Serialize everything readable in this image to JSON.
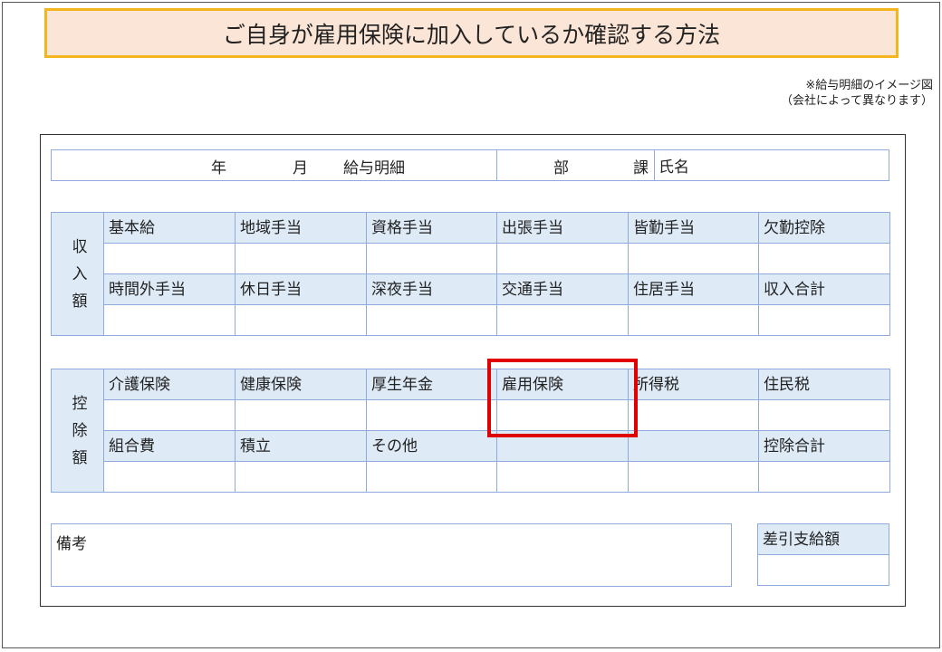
{
  "title": "ご自身が雇用保険に加入しているか確認する方法",
  "note": {
    "line1": "※給与明細のイメージ図",
    "line2": "（会社によって異なります）"
  },
  "header": {
    "year": "年",
    "month": "月",
    "slip_label": "給与明細",
    "dept": "部",
    "section": "課",
    "name_label": "氏名"
  },
  "income": {
    "side_chars": [
      "収",
      "入",
      "額"
    ],
    "row1": [
      "基本給",
      "地域手当",
      "資格手当",
      "出張手当",
      "皆勤手当",
      "欠勤控除"
    ],
    "row2": [
      "時間外手当",
      "休日手当",
      "深夜手当",
      "交通手当",
      "住居手当",
      "収入合計"
    ]
  },
  "deduction": {
    "side_chars": [
      "控",
      "除",
      "額"
    ],
    "row1": [
      "介護保険",
      "健康保険",
      "厚生年金",
      "雇用保険",
      "所得税",
      "住民税"
    ],
    "row2": [
      "組合費",
      "積立",
      "その他",
      "",
      "",
      "控除合計"
    ]
  },
  "memo_label": "備考",
  "net_pay_label": "差引支給額",
  "highlight_color": "#e00000",
  "label_fill": "#deebf7",
  "grid_color": "#8faadc",
  "title_fill": "#fbe5d6",
  "title_border": "#f3b61f"
}
